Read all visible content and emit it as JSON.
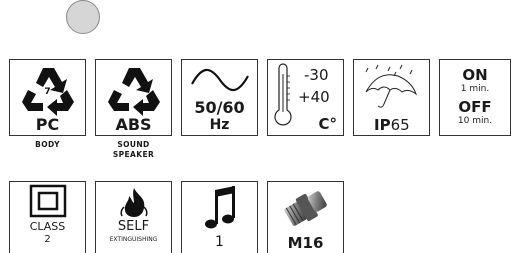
{
  "row1": {
    "pc": {
      "code": "7",
      "label": "PC",
      "caption": "BODY"
    },
    "abs": {
      "label": "ABS",
      "caption_line1": "SOUND",
      "caption_line2": "SPEAKER"
    },
    "frequency": {
      "line1": "50/60",
      "line2": "Hz"
    },
    "temperature": {
      "min": "-30",
      "max": "+40",
      "unit": "C°"
    },
    "ip": {
      "prefix": "IP",
      "number": "65"
    },
    "timing": {
      "on": "ON",
      "on_time": "1 min.",
      "off": "OFF",
      "off_time": "10 min."
    }
  },
  "row2": {
    "class": {
      "line1": "CLASS",
      "line2": "2"
    },
    "self": {
      "line1": "SELF",
      "line2": "EXTINGUISHING"
    },
    "sound": {
      "value": "1"
    },
    "gland": {
      "label": "M16"
    }
  }
}
